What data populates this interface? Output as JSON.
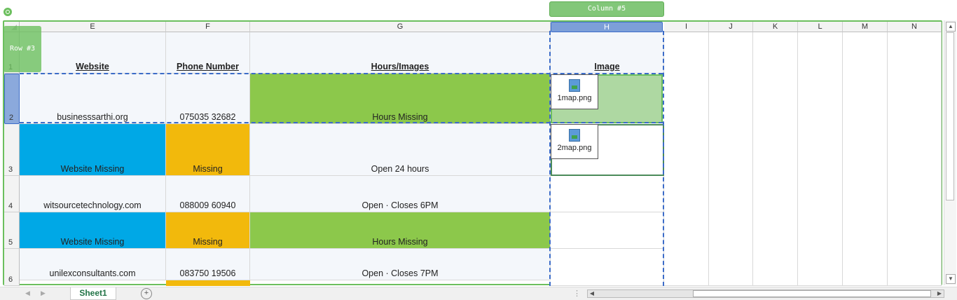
{
  "overlay": {
    "column_tag": "Column #5",
    "row_tag": "Row #3"
  },
  "columns": [
    "E",
    "F",
    "G",
    "H",
    "I",
    "J",
    "K",
    "L",
    "M",
    "N"
  ],
  "rows": [
    "1",
    "2",
    "3",
    "4",
    "5",
    "6"
  ],
  "headers": {
    "website": "Website",
    "phone": "Phone Number",
    "hours": "Hours/Images",
    "image": "Image"
  },
  "data_rows": [
    {
      "website": "businesssarthi.org",
      "phone": "075035 32682",
      "hours": "Hours Missing",
      "image": "1map.png"
    },
    {
      "website": "Website Missing",
      "phone": "Missing",
      "hours": "Open 24 hours",
      "image": "2map.png"
    },
    {
      "website": "witsourcetechnology.com",
      "phone": "088009 60940",
      "hours": "Open · Closes 6PM",
      "image": ""
    },
    {
      "website": "Website Missing",
      "phone": "Missing",
      "hours": "Hours Missing",
      "image": ""
    },
    {
      "website": "unilexconsultants.com",
      "phone": "083750 19506",
      "hours": "Open · Closes 7PM",
      "image": ""
    }
  ],
  "sheet_tab": "Sheet1",
  "colors": {
    "missing_website": "#00a8e6",
    "missing_phone": "#f2b90c",
    "missing_hours": "#8cc84b",
    "selection": "#6cbf5e"
  }
}
